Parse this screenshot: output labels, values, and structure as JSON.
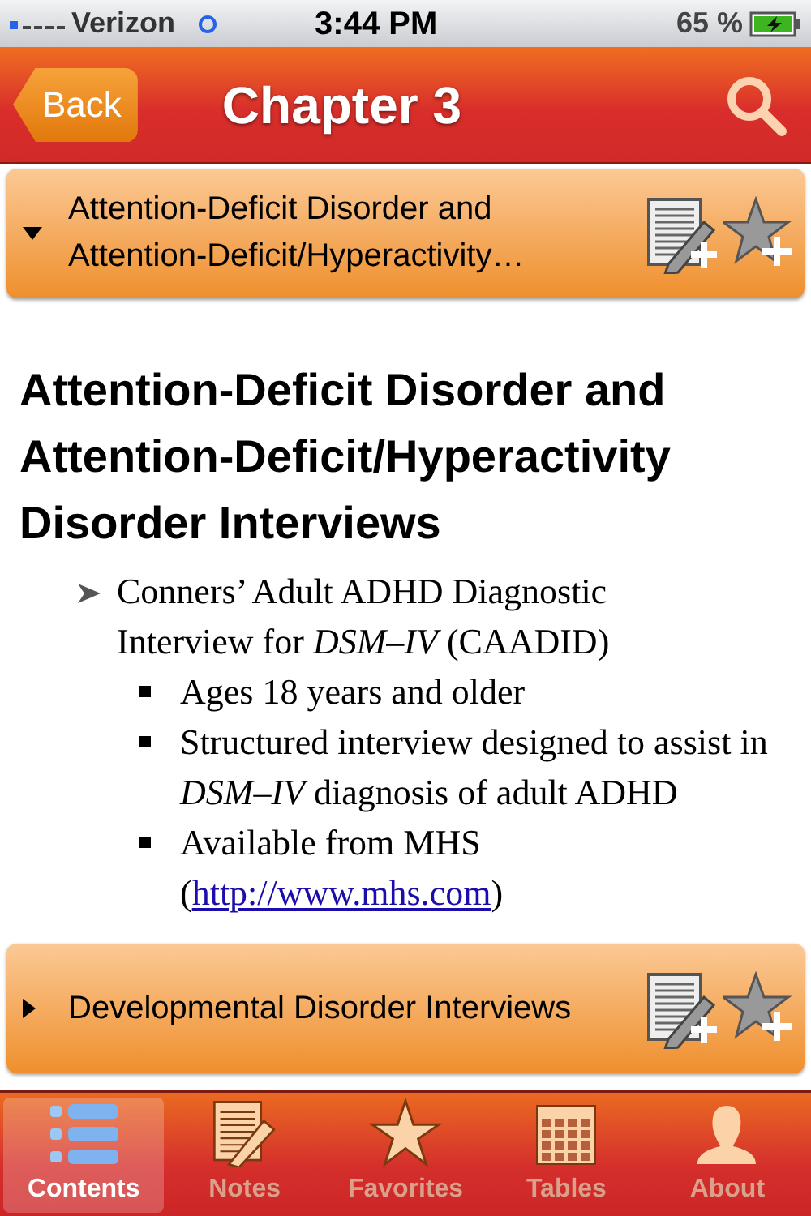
{
  "status_bar": {
    "carrier": "Verizon",
    "time": "3:44 PM",
    "battery": "65 %"
  },
  "nav": {
    "back": "Back",
    "title": "Chapter 3"
  },
  "sections": [
    {
      "title": "Attention-Deficit Disorder and Attention-Deficit/Hyperactivity…",
      "expanded": true,
      "heading": "Attention-Deficit Disorder and Attention-Deficit/Hyperactivity Disorder Interviews",
      "items": [
        {
          "text": "Conners’ Adult ADHD Diagnostic Interview for *DSM–IV* (CAADID)",
          "children": [
            {
              "text": "Ages 18 years and older"
            },
            {
              "text": "Structured interview designed to assist in *DSM–IV* diagnosis of adult ADHD"
            },
            {
              "text": "Available from MHS (",
              "link": "http://www.mhs.com",
              "after": ")"
            }
          ]
        }
      ]
    },
    {
      "title": "Developmental Disorder Interviews",
      "expanded": false
    }
  ],
  "tabs": [
    {
      "label": "Contents",
      "kind": "list",
      "selected": true
    },
    {
      "label": "Notes",
      "kind": "notes",
      "selected": false
    },
    {
      "label": "Favorites",
      "kind": "star",
      "selected": false
    },
    {
      "label": "Tables",
      "kind": "calendar",
      "selected": false
    },
    {
      "label": "About",
      "kind": "person",
      "selected": false
    }
  ]
}
